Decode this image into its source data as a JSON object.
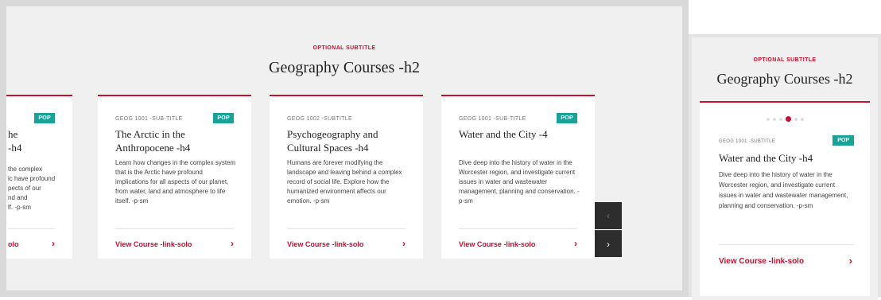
{
  "section": {
    "subtitle": "OPTIONAL SUBTITLE",
    "title": "Geography Courses -h2"
  },
  "cards": [
    {
      "subtitle": "",
      "badge": "POP",
      "title_lines": [
        "he",
        "-h4"
      ],
      "desc_lines": [
        "the complex",
        "ic have profound",
        "pects of our",
        "nd and",
        "lf. -p-sm"
      ],
      "link": "olo",
      "arrow": "›"
    },
    {
      "subtitle": "GEOG 1001 -SUB-TITLE",
      "badge": "POP",
      "title": "The Arctic in the Anthropocene -h4",
      "desc": "Learn how changes in the complex system that is the Arctic have profound implications for all aspects of our planet, from water, land and atmosphere to life itself. -p-sm",
      "link": "View Course -link-solo",
      "arrow": "›"
    },
    {
      "subtitle": "GEOG 1002 -SUBTITLE",
      "title": "Psychogeography and Cultural Spaces -h4",
      "desc": "Humans are forever modifying the landscape and leaving behind a complex record of social life. Explore how the humanized environment affects our emotion. -p-sm",
      "link": "View Course -link-solo",
      "arrow": "›"
    },
    {
      "subtitle": "GEOG 1001 -SUB-TITLE",
      "badge": "POP",
      "title": "Water and the City -4",
      "desc": "Dive deep into the history of water in the Worcester region, and investigate current issues in water and wastewater management, planning and conservation. -p-sm",
      "link": "View Course -link-solo",
      "arrow": "›"
    }
  ],
  "nav": {
    "prev": "‹",
    "next": "›"
  },
  "mobile": {
    "subtitle": "OPTIONAL SUBTITLE",
    "title": "Geography Courses -h2",
    "pager": {
      "total": 6,
      "active_index": 3
    },
    "card": {
      "subtitle": "GEOG 1001 -SUBTITLE",
      "badge": "POP",
      "title": "Water and the City -h4",
      "desc": "Dive deep into the history of water in the Worcester region, and investigate current issues in water and wastewater management, planning and conservation. -p-sm",
      "link": "View Course -link-solo",
      "arrow": "›"
    }
  },
  "colors": {
    "accent": "#c8102e",
    "badge": "#17a398",
    "nav_bg": "#2d2d2d"
  }
}
